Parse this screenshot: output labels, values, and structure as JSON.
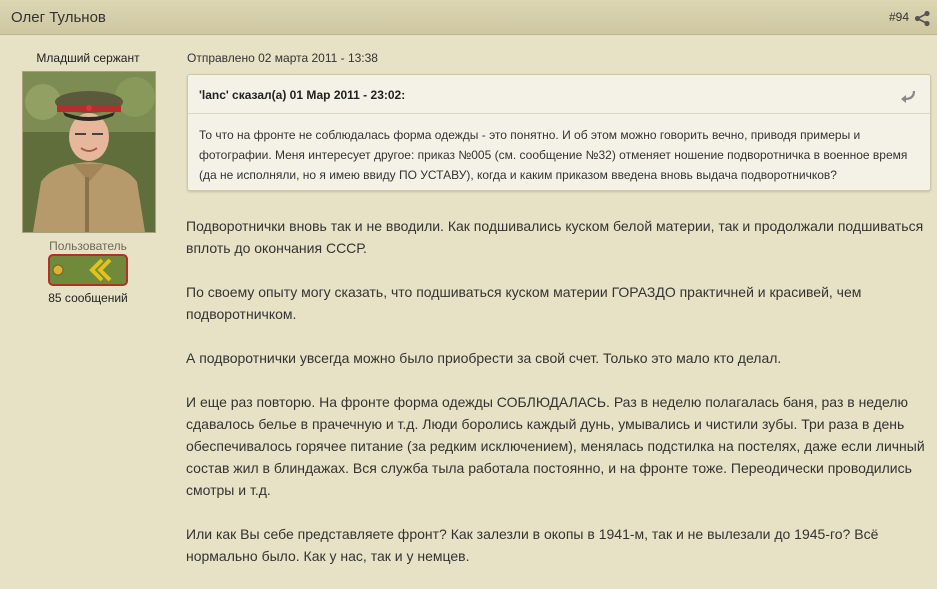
{
  "header": {
    "author_name": "Олег Тульнов",
    "post_number": "#94",
    "share_icon": "share-icon"
  },
  "author": {
    "rank_title": "Младший сержант",
    "usergroup": "Пользователь",
    "post_count": "85 сообщений",
    "rank_badge_icon": "rank-shoulder-strap-icon"
  },
  "post": {
    "date": "Отправлено 02 марта 2011 - 13:38",
    "quote": {
      "header": "'lanc' сказал(а) 01 Мар 2011 - 23:02:",
      "text": "То что на фронте не соблюдалась форма одежды - это понятно. И об этом можно говорить вечно, приводя примеры и фотографии. Меня интересует другое: приказ №005 (см. сообщение №32) отменяет ношение подворотничка в военное время (да не исполняли, но я имею ввиду ПО УСТАВУ), когда и каким приказом введена вновь выдача подворотничков?",
      "jump_icon": "jump-to-post-icon"
    },
    "paragraphs": [
      "Подворотнички вновь так и не вводили. Как подшивались куском белой материи, так и продолжали подшиваться вплоть до окончания СССР.",
      "По своему опыту могу сказать, что подшиваться куском материи ГОРАЗДО практичней и красивей, чем подворотничком.",
      "А подворотнички увсегда можно было приобрести за свой счет. Только это мало кто делал.",
      "И еще раз повторю. На фронте форма одежды СОБЛЮДАЛАСЬ. Раз в неделю полагалась баня, раз в неделю сдавалось белье в прачечную и т.д. Люди боролись каждый дунь, умывались и чистили зубы. Три раза в день обеспечивалось горячее питание (за редким исключением), менялась подстилка на постелях, даже если личный состав жил в блиндажах. Вся служба тыла работала постоянно, и на фронте тоже. Переодически проводились смотры и т.д.",
      "Или как Вы себе представляете фронт? Как залезли в окопы в 1941-м, так и не вылезали до 1945-го? Всё нормально было. Как у нас, так и у немцев."
    ]
  },
  "colors": {
    "page_background": "#e7e1c5",
    "header_background": "#d4cdaa",
    "quote_background": "#f4f2e7",
    "rank_badge_green": "#6f8a3a",
    "rank_badge_stripe": "#e3c21d"
  }
}
